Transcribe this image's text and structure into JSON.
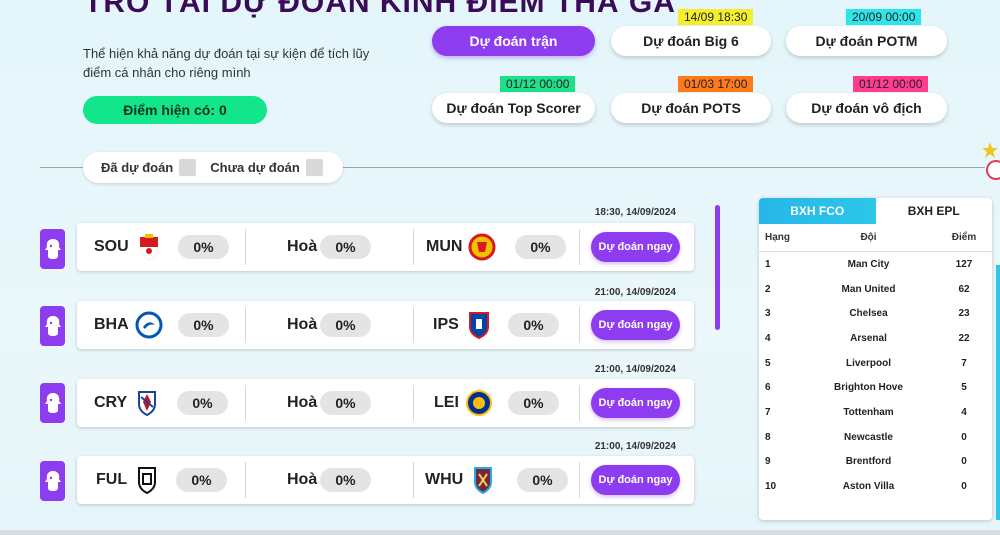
{
  "header": {
    "title": "TRỔ TÀI DỰ ĐOÁN KÍNH ĐIỂM THẢ GA",
    "description": "Thể hiện khả năng dự đoán tại sự kiện để tích lũy điểm cá nhân cho riêng mình",
    "points_label": "Điểm hiện có:",
    "points_value": "0"
  },
  "prediction_types": [
    {
      "label": "Dự đoán trận",
      "tag": "",
      "active": true
    },
    {
      "label": "Dự đoán Big 6",
      "tag": "14/09 18:30",
      "tag_color": "#f4ef2a"
    },
    {
      "label": "Dự đoán POTM",
      "tag": "20/09 00:00",
      "tag_color": "#2ee6ea"
    },
    {
      "label": "Dự đoán Top Scorer",
      "tag": "01/12 00:00",
      "tag_color": "#1fe08a"
    },
    {
      "label": "Dự đoán POTS",
      "tag": "01/03 17:00",
      "tag_color": "#ff7a1a"
    },
    {
      "label": "Dự đoán vô địch",
      "tag": "01/12 00:00",
      "tag_color": "#ff3d8f"
    }
  ],
  "filter": {
    "predicted_label": "Đã dự đoán",
    "not_predicted_label": "Chưa dự đoán"
  },
  "matches": [
    {
      "time": "18:30, 14/09/2024",
      "home": "SOU",
      "home_pct": "0%",
      "draw_label": "Hoà",
      "draw_pct": "0%",
      "away": "MUN",
      "away_pct": "0%",
      "button": "Dự đoán ngay"
    },
    {
      "time": "21:00, 14/09/2024",
      "home": "BHA",
      "home_pct": "0%",
      "draw_label": "Hoà",
      "draw_pct": "0%",
      "away": "IPS",
      "away_pct": "0%",
      "button": "Dự đoán ngay"
    },
    {
      "time": "21:00, 14/09/2024",
      "home": "CRY",
      "home_pct": "0%",
      "draw_label": "Hoà",
      "draw_pct": "0%",
      "away": "LEI",
      "away_pct": "0%",
      "button": "Dự đoán ngay"
    },
    {
      "time": "21:00, 14/09/2024",
      "home": "FUL",
      "home_pct": "0%",
      "draw_label": "Hoà",
      "draw_pct": "0%",
      "away": "WHU",
      "away_pct": "0%",
      "button": "Dự đoán ngay"
    }
  ],
  "standings": {
    "tabs": [
      "BXH FCO",
      "BXH EPL"
    ],
    "headers": [
      "Hạng",
      "Đội",
      "Điểm"
    ],
    "rows": [
      {
        "rank": "1",
        "team": "Man City",
        "points": "127"
      },
      {
        "rank": "2",
        "team": "Man United",
        "points": "62"
      },
      {
        "rank": "3",
        "team": "Chelsea",
        "points": "23"
      },
      {
        "rank": "4",
        "team": "Arsenal",
        "points": "22"
      },
      {
        "rank": "5",
        "team": "Liverpool",
        "points": "7"
      },
      {
        "rank": "6",
        "team": "Brighton Hove",
        "points": "5"
      },
      {
        "rank": "7",
        "team": "Tottenham",
        "points": "4"
      },
      {
        "rank": "8",
        "team": "Newcastle",
        "points": "0"
      },
      {
        "rank": "9",
        "team": "Brentford",
        "points": "0"
      },
      {
        "rank": "10",
        "team": "Aston Villa",
        "points": "0"
      }
    ]
  },
  "colors": {
    "accent": "#8d3cf0",
    "points_pill": "#12e58a",
    "standings_tab": "#27b6e8"
  },
  "icons": {
    "league": "premier-league-lion-icon",
    "team_crest": "club-crest-icon"
  }
}
